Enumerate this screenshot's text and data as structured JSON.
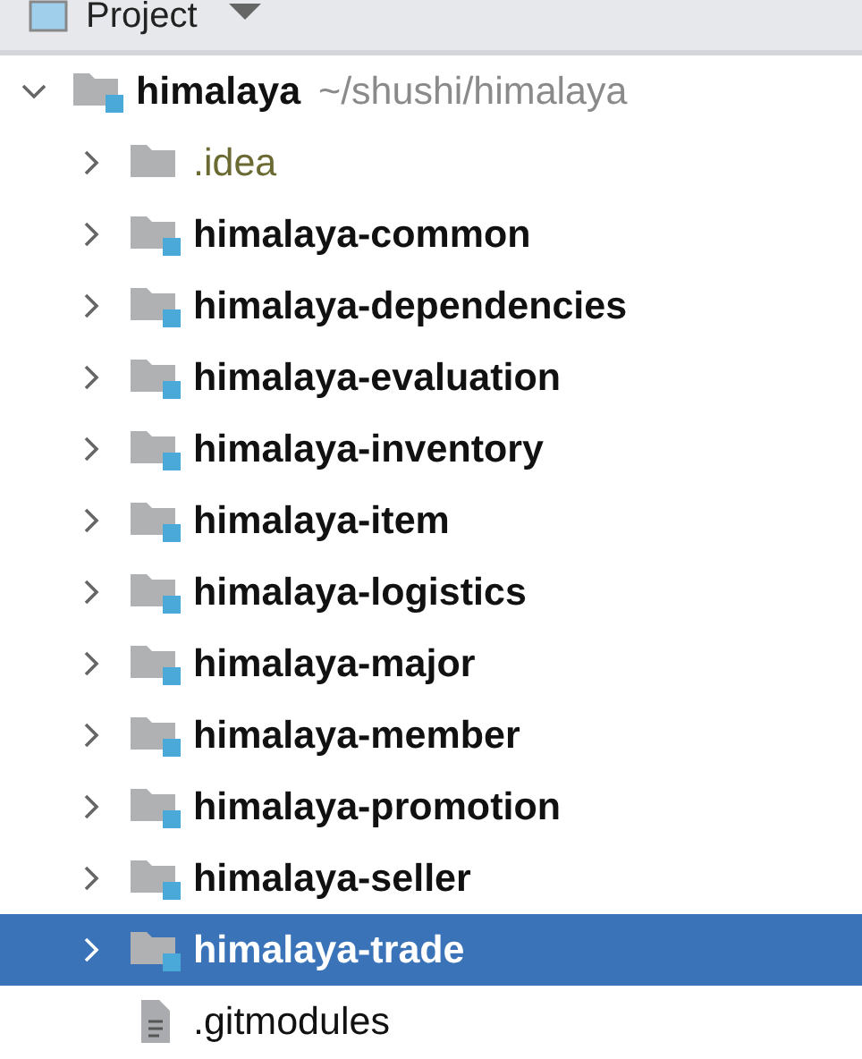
{
  "header": {
    "title": "Project"
  },
  "tree": {
    "label": "himalaya",
    "path": "~/shushi/himalaya",
    "kind": "module",
    "expanded": true,
    "selected": false,
    "children": [
      {
        "label": ".idea",
        "kind": "config-folder",
        "expanded": false,
        "selected": false
      },
      {
        "label": "himalaya-common",
        "kind": "module",
        "expanded": false,
        "selected": false
      },
      {
        "label": "himalaya-dependencies",
        "kind": "module",
        "expanded": false,
        "selected": false
      },
      {
        "label": "himalaya-evaluation",
        "kind": "module",
        "expanded": false,
        "selected": false
      },
      {
        "label": "himalaya-inventory",
        "kind": "module",
        "expanded": false,
        "selected": false
      },
      {
        "label": "himalaya-item",
        "kind": "module",
        "expanded": false,
        "selected": false
      },
      {
        "label": "himalaya-logistics",
        "kind": "module",
        "expanded": false,
        "selected": false
      },
      {
        "label": "himalaya-major",
        "kind": "module",
        "expanded": false,
        "selected": false
      },
      {
        "label": "himalaya-member",
        "kind": "module",
        "expanded": false,
        "selected": false
      },
      {
        "label": "himalaya-promotion",
        "kind": "module",
        "expanded": false,
        "selected": false
      },
      {
        "label": "himalaya-seller",
        "kind": "module",
        "expanded": false,
        "selected": false
      },
      {
        "label": "himalaya-trade",
        "kind": "module",
        "expanded": false,
        "selected": true
      },
      {
        "label": ".gitmodules",
        "kind": "file",
        "selected": false
      }
    ]
  }
}
